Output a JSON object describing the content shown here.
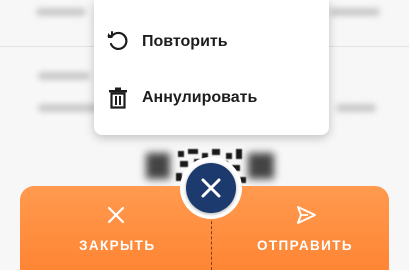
{
  "menu": {
    "items": [
      {
        "label": "Повторить",
        "icon": "repeat-icon"
      },
      {
        "label": "Аннулировать",
        "icon": "trash-icon"
      }
    ]
  },
  "actions": {
    "close_label": "ЗАКРЫТЬ",
    "send_label": "ОТПРАВИТЬ",
    "close_icon": "close-icon",
    "send_icon": "send-icon"
  },
  "fab": {
    "icon": "close-icon"
  },
  "colors": {
    "accent_orange": "#ff8c3f",
    "fab_navy": "#1c3a6e",
    "menu_bg": "#ffffff",
    "text_dark": "#1d1d1d"
  }
}
